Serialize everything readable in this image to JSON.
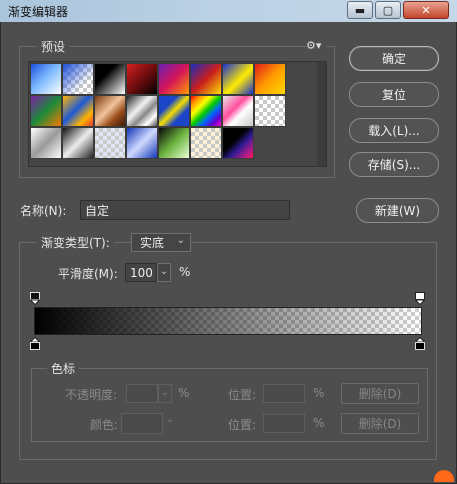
{
  "window": {
    "title": "渐变编辑器",
    "controls": {
      "minimize": "▬",
      "maximize": "▢",
      "close": "✕"
    }
  },
  "presets": {
    "label": "预设",
    "menu_icon": "gear-icon",
    "swatch_count": 24
  },
  "buttons": {
    "ok": "确定",
    "reset": "复位",
    "load": "载入(L)...",
    "save": "存储(S)...",
    "new": "新建(W)"
  },
  "name": {
    "label": "名称(N):",
    "value": "自定"
  },
  "gradient": {
    "type_label": "渐变类型(T):",
    "type_value": "实底",
    "smoothness_label": "平滑度(M):",
    "smoothness_value": "100",
    "smoothness_unit": "%"
  },
  "stops": {
    "title": "色标",
    "opacity_label": "不透明度:",
    "opacity_unit": "%",
    "color_label": "颜色:",
    "location_label_1": "位置:",
    "location_unit_1": "%",
    "location_label_2": "位置:",
    "location_unit_2": "%",
    "delete_1": "删除(D)",
    "delete_2": "删除(D)"
  },
  "colors": {
    "dialog_bg": "#4e4e4e",
    "titlebar": "#b9cfe3",
    "close": "#c2452c"
  }
}
